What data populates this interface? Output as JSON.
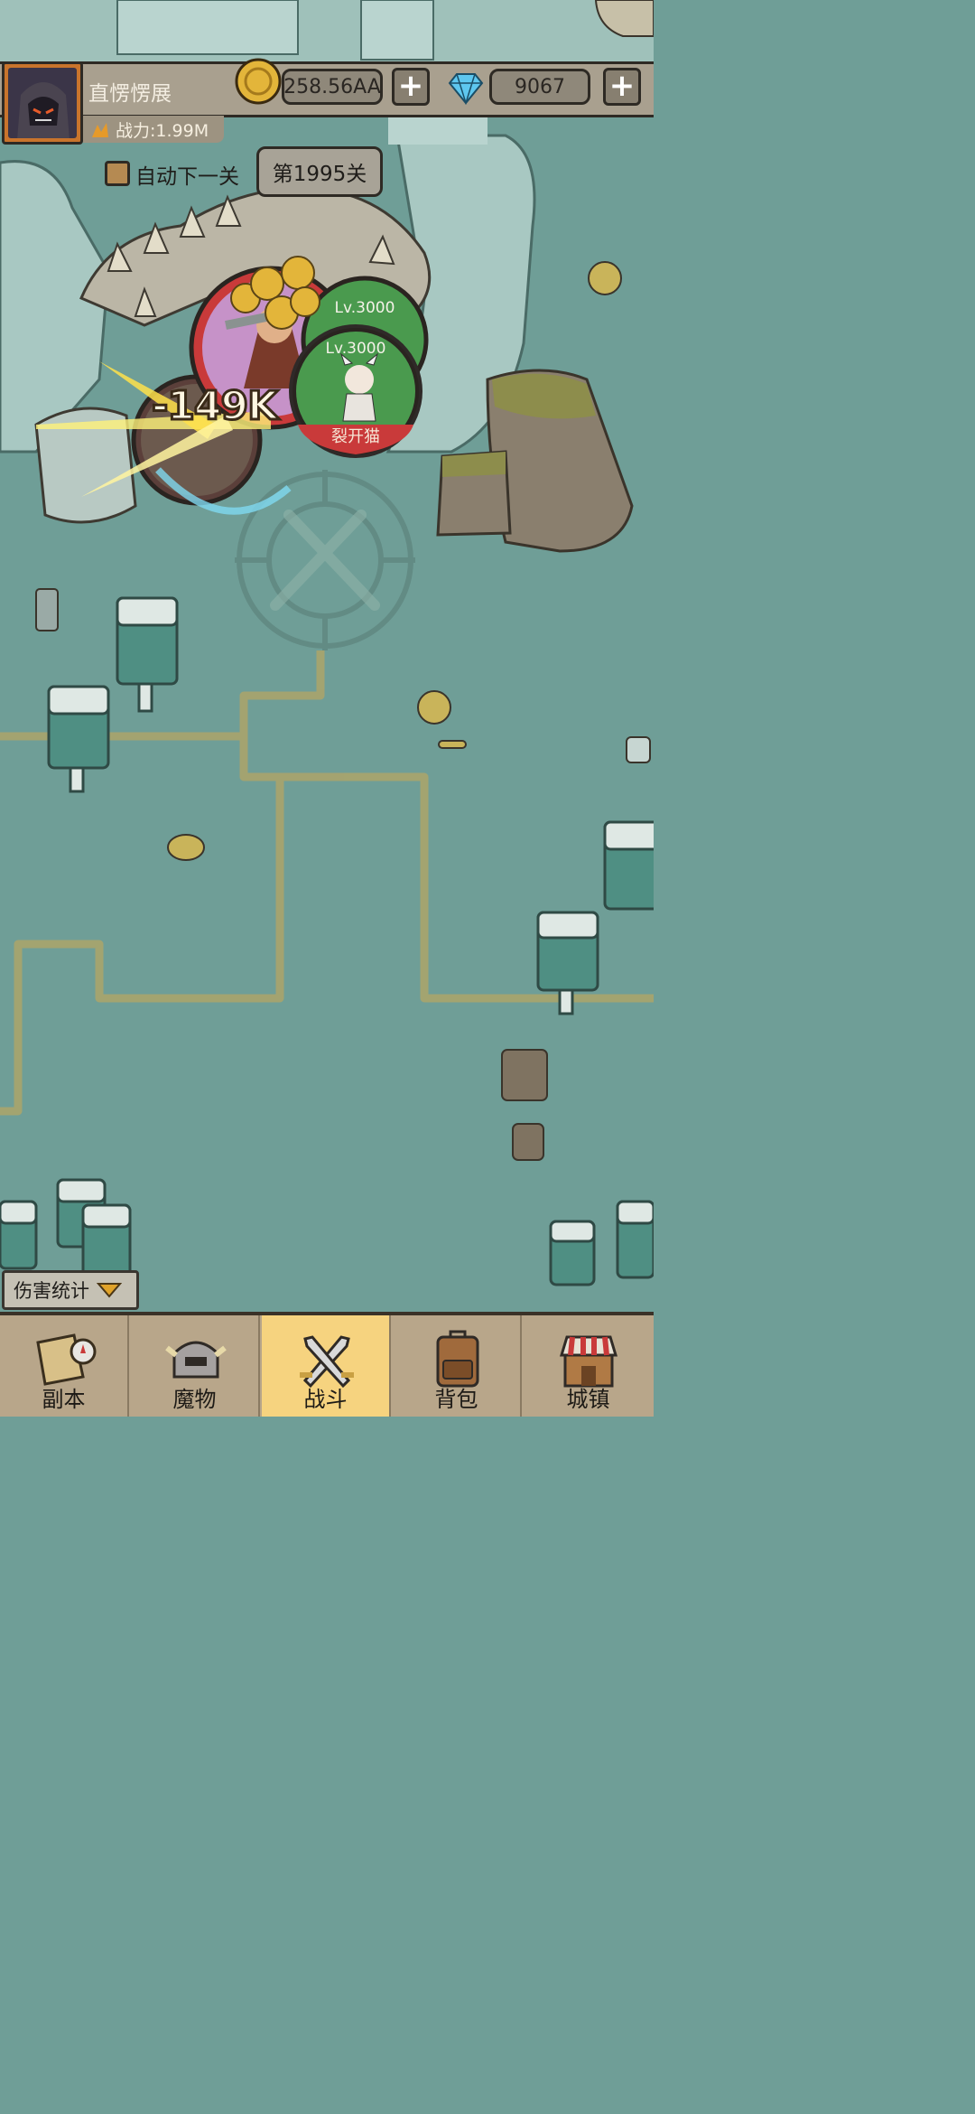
{
  "player": {
    "name": "直愣愣展",
    "power": "战力:1.99M"
  },
  "currency": {
    "gold": "258.56AA",
    "diamond": "9067",
    "plus": "+"
  },
  "stage": {
    "auto_next_label": "自动下一关",
    "current": "第1995关"
  },
  "battle": {
    "damage_popup": "-149K",
    "units": [
      {
        "level": "Lv.3000",
        "name": "裂开猫"
      },
      {
        "level": "Lv.3000",
        "name": ""
      }
    ]
  },
  "damage_stats": {
    "label": "伤害统计"
  },
  "nav": {
    "items": [
      {
        "label": "副本",
        "icon": "map-compass-icon",
        "active": false
      },
      {
        "label": "魔物",
        "icon": "helmet-icon",
        "active": false
      },
      {
        "label": "战斗",
        "icon": "crossed-swords-icon",
        "active": true
      },
      {
        "label": "背包",
        "icon": "backpack-icon",
        "active": false
      },
      {
        "label": "城镇",
        "icon": "shop-icon",
        "active": false
      }
    ]
  },
  "colors": {
    "background": "#6f9e97",
    "nav_active": "#f6d37f",
    "hp_green": "#4a9a4e",
    "enemy_red": "#c93a3a"
  }
}
